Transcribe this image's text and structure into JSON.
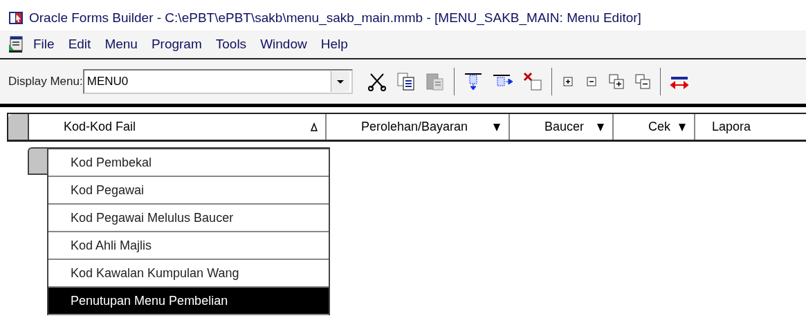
{
  "window": {
    "title": "Oracle Forms Builder - C:\\ePBT\\ePBT\\sakb\\menu_sakb_main.mmb - [MENU_SAKB_MAIN: Menu Editor]"
  },
  "menu_bar": [
    "File",
    "Edit",
    "Menu",
    "Program",
    "Tools",
    "Window",
    "Help"
  ],
  "toolbar": {
    "display_menu_label": "Display Menu:",
    "display_menu_value": "MENU0"
  },
  "menu_editor": {
    "top_items": [
      {
        "label": "Kod-Kod Fail",
        "expanded": true
      },
      {
        "label": "Perolehan/Bayaran",
        "expanded": false
      },
      {
        "label": "Baucer",
        "expanded": false
      },
      {
        "label": "Cek",
        "expanded": false
      },
      {
        "label": "Lapora"
      }
    ],
    "sub_items": [
      {
        "label": "Kod Pembekal",
        "selected": false
      },
      {
        "label": "Kod Pegawai",
        "selected": false
      },
      {
        "label": "Kod Pegawai Melulus Baucer",
        "selected": false
      },
      {
        "label": "Kod Ahli Majlis",
        "selected": false
      },
      {
        "label": "Kod Kawalan Kumpulan Wang",
        "selected": false
      },
      {
        "label": "Penutupan Menu Pembelian",
        "selected": true
      }
    ]
  }
}
